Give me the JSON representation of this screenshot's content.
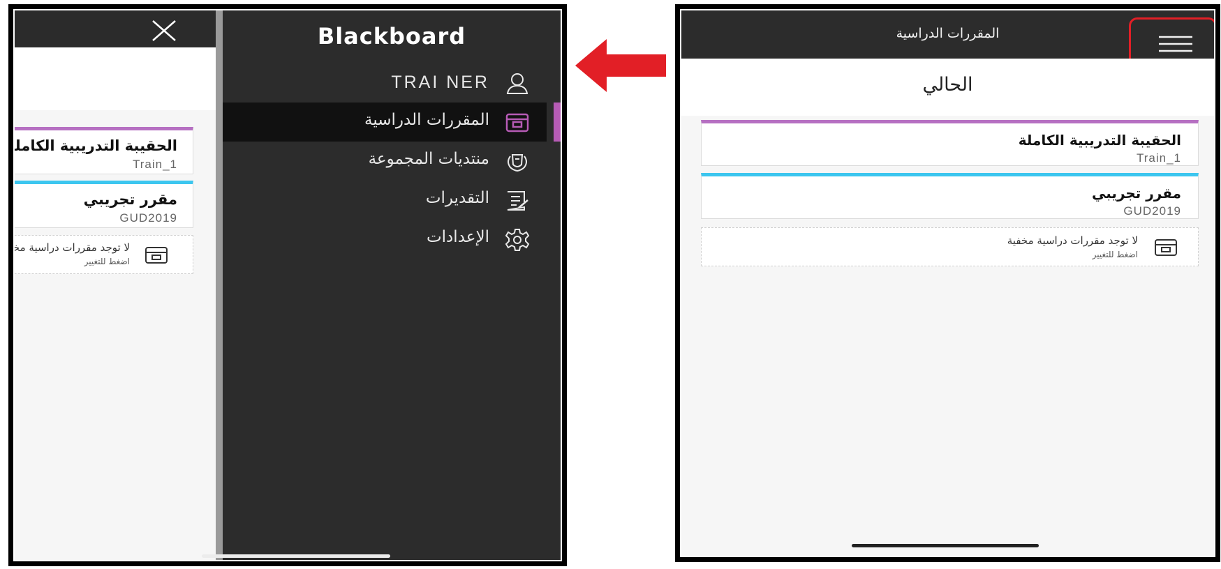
{
  "colors": {
    "dark_bar": "#2c2c2c",
    "active_item_bg": "#111111",
    "active_accent": "#b65bb5",
    "course_1_accent": "#b670c2",
    "course_2_accent": "#3cc6ef",
    "highlight_red": "#e21f26"
  },
  "left_phone": {
    "close_icon": "close-icon",
    "drawer": {
      "logo": "Blackboard",
      "items": [
        {
          "label": "TRAI NER",
          "icon": "user-icon",
          "active": false
        },
        {
          "label": "المقررات الدراسية",
          "icon": "courses-icon",
          "active": true
        },
        {
          "label": "منتديات المجموعة",
          "icon": "organizations-icon",
          "active": false
        },
        {
          "label": "التقديرات",
          "icon": "grades-icon",
          "active": false
        },
        {
          "label": "الإعدادات",
          "icon": "settings-icon",
          "active": false
        }
      ]
    },
    "courses": [
      {
        "title": "الحقيبة التدريبية الكاملة",
        "code": "Train_1"
      },
      {
        "title": "مقرر تجريبي",
        "code": "GUD2019"
      }
    ],
    "hidden_courses": {
      "text": "لا توجد مقررات دراسية مخفية",
      "hint": "اضغط للتغيير"
    }
  },
  "arrow": {
    "icon": "arrow-left-icon",
    "color": "#e21f26"
  },
  "right_phone": {
    "title": "المقررات الدراسية",
    "menu_icon": "hamburger-menu-icon",
    "section_heading": "الحالي",
    "courses": [
      {
        "title": "الحقيبة التدريبية الكاملة",
        "code": "Train_1"
      },
      {
        "title": "مقرر تجريبي",
        "code": "GUD2019"
      }
    ],
    "hidden_courses": {
      "text": "لا توجد مقررات دراسية مخفية",
      "hint": "اضغط للتغيير"
    }
  }
}
